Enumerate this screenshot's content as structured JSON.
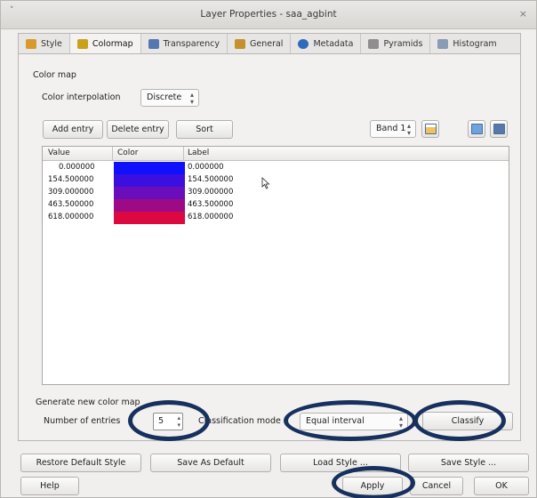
{
  "window": {
    "title": "Layer Properties - saa_agbint",
    "menu_glyph": "˅",
    "close_glyph": "×"
  },
  "tabs": [
    {
      "label": "Style",
      "icon": "style-icon",
      "color": "#d99a2b"
    },
    {
      "label": "Colormap",
      "icon": "colormap-icon",
      "color": "#c9a21a",
      "active": true
    },
    {
      "label": "Transparency",
      "icon": "transparency-icon",
      "color": "#5477b1"
    },
    {
      "label": "General",
      "icon": "general-icon",
      "color": "#c4922b"
    },
    {
      "label": "Metadata",
      "icon": "metadata-icon",
      "color": "#2e6bbd"
    },
    {
      "label": "Pyramids",
      "icon": "pyramids-icon",
      "color": "#8e8e8e"
    },
    {
      "label": "Histogram",
      "icon": "histogram-icon",
      "color": "#8a9bb5"
    }
  ],
  "colormap": {
    "section_title": "Color map",
    "interpolation_label": "Color interpolation",
    "interpolation_value": "Discrete",
    "add_entry": "Add entry",
    "delete_entry": "Delete entry",
    "sort": "Sort",
    "band_value": "Band 1",
    "table": {
      "columns": [
        "Value",
        "Color",
        "Label"
      ],
      "rows": [
        {
          "value": "0.000000",
          "color": "#1010ff",
          "label": "0.000000"
        },
        {
          "value": "154.500000",
          "color": "#3a0fe0",
          "label": "154.500000"
        },
        {
          "value": "309.000000",
          "color": "#6a0dbb",
          "label": "309.000000"
        },
        {
          "value": "463.500000",
          "color": "#9e0a85",
          "label": "463.500000"
        },
        {
          "value": "618.000000",
          "color": "#dd0840",
          "label": "618.000000"
        }
      ]
    }
  },
  "generate": {
    "section_title": "Generate new color map",
    "entries_label": "Number of entries",
    "entries_value": "5",
    "mode_label": "Classification mode",
    "mode_value": "Equal interval",
    "classify": "Classify"
  },
  "footer": {
    "restore": "Restore Default Style",
    "save_default": "Save As Default",
    "load": "Load Style ...",
    "save": "Save Style ...",
    "help": "Help",
    "apply": "Apply",
    "cancel": "Cancel",
    "ok": "OK"
  },
  "colors": {
    "highlight_ring": "#17305e"
  }
}
